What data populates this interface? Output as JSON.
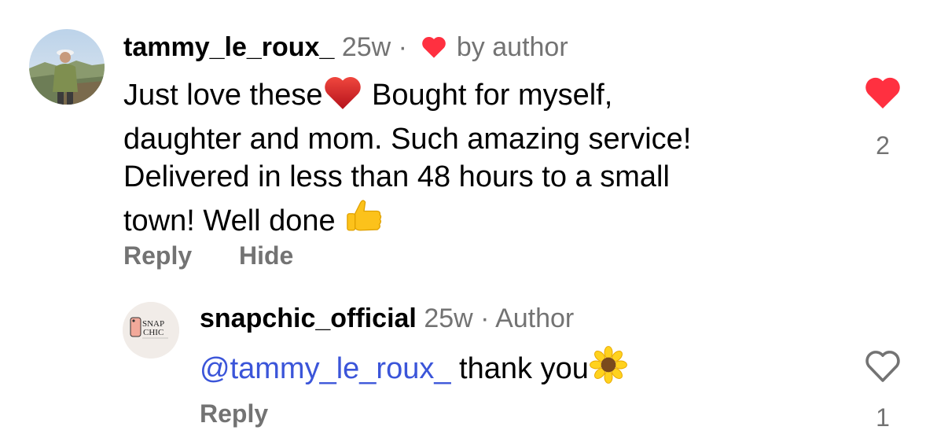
{
  "comment": {
    "username": "tammy_le_roux_",
    "time": "25w",
    "separator": "·",
    "liked_by": "by author",
    "text_1": "Just love these",
    "text_2": "Bought for myself,",
    "text_3": "daughter and mom. Such amazing service!",
    "text_4": "Delivered in less than 48 hours to a small",
    "text_5": "town! Well done",
    "reply_label": "Reply",
    "hide_label": "Hide",
    "like_count": "2",
    "liked": true
  },
  "reply": {
    "username": "snapchic_official",
    "time": "25w",
    "separator": "·",
    "badge": "Author",
    "mention": "@tammy_le_roux_",
    "text": "thank you",
    "reply_label": "Reply",
    "like_count": "1",
    "liked": false,
    "avatar_logo_line1": "SNAP",
    "avatar_logo_line2": "CHIC"
  },
  "colors": {
    "heart_red": "#ff3040",
    "muted_gray": "#737373",
    "mention_blue": "#3b55d9"
  },
  "icons": [
    "heart-filled-icon",
    "heart-outline-icon",
    "red-heart-emoji",
    "thumbs-up-emoji",
    "sunflower-emoji"
  ]
}
